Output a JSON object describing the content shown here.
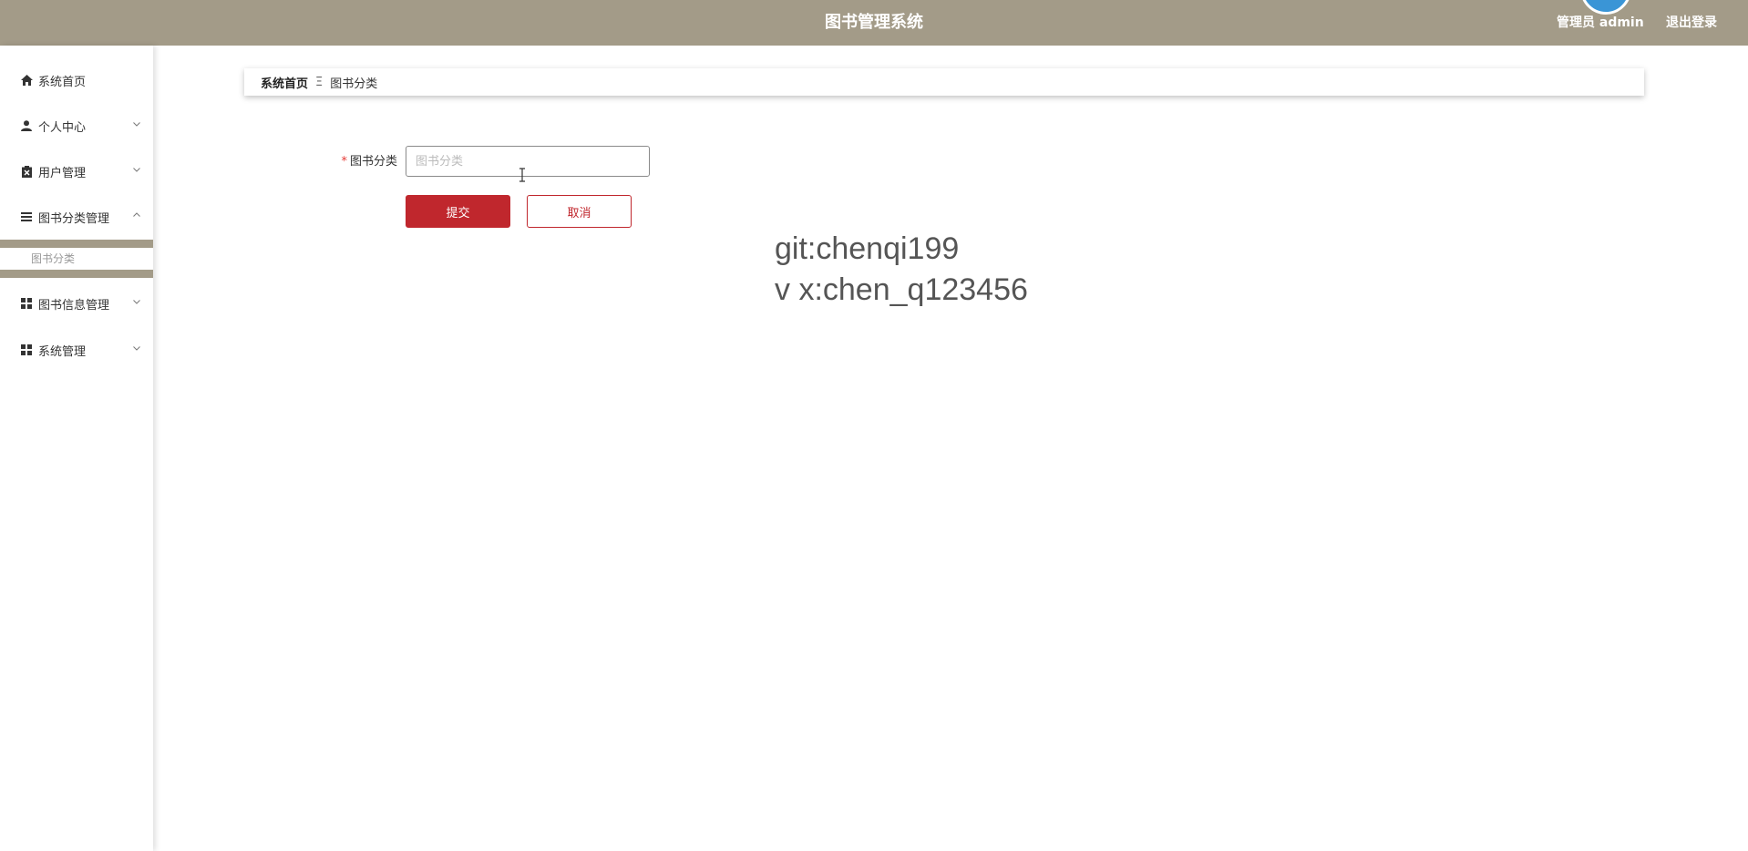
{
  "header": {
    "title": "图书管理系统",
    "user_label": "管理员 admin",
    "logout_label": "退出登录",
    "bg_color": "#a39b88"
  },
  "sidebar": {
    "items": [
      {
        "label": "系统首页",
        "icon": "home-icon"
      },
      {
        "label": "个人中心",
        "icon": "user-icon"
      },
      {
        "label": "用户管理",
        "icon": "clipboard-icon"
      },
      {
        "label": "图书分类管理",
        "icon": "list-icon"
      },
      {
        "label": "图书信息管理",
        "icon": "grid-icon"
      },
      {
        "label": "系统管理",
        "icon": "grid-icon"
      }
    ],
    "submenu": {
      "label": "图书分类"
    }
  },
  "breadcrumb": {
    "home": "系统首页",
    "separator": "Ξ",
    "current": "图书分类"
  },
  "form": {
    "required_mark": "*",
    "category_label": "图书分类",
    "category_placeholder": "图书分类",
    "category_value": "",
    "submit_label": "提交",
    "cancel_label": "取消"
  },
  "watermark": {
    "line1": "git:chenqi199",
    "line2": "v x:chen_q123456"
  },
  "colors": {
    "accent": "#c0272d",
    "header": "#a39b88"
  }
}
